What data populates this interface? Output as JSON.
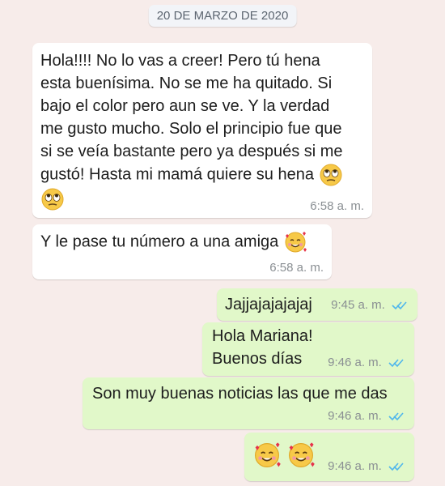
{
  "date_separator": "20 DE MARZO DE 2020",
  "messages": [
    {
      "text_lines": [
        "Hola!!!! No lo vas a creer! Pero tú hena",
        "esta buenísima. No se me ha quitado. Si",
        "bajo el color pero aun se ve. Y la verdad",
        "me gusto mucho. Solo el principio fue que",
        "si se veía bastante pero ya después si me",
        "gustó! Hasta mi mamá quiere su hena"
      ],
      "emojis": [
        "rolling-eyes",
        "rolling-eyes"
      ],
      "time": "6:58 a. m."
    },
    {
      "text": "Y le pase tu número a una amiga",
      "emojis": [
        "smiling-face-with-hearts"
      ],
      "time": "6:58 a. m."
    },
    {
      "text": "Jajjajajajajaj",
      "time": "9:45 a. m.",
      "status": "read"
    },
    {
      "text_lines": [
        "Hola Mariana!",
        "Buenos días"
      ],
      "time": "9:46 a. m.",
      "status": "read"
    },
    {
      "text": "Son muy buenas noticias las que me das",
      "time": "9:46 a. m.",
      "status": "read"
    },
    {
      "emojis": [
        "smiling-face-with-hearts",
        "smiling-face-with-hearts"
      ],
      "time": "9:46 a. m.",
      "status": "read"
    }
  ],
  "colors": {
    "background": "#f7ecea",
    "incoming_bubble": "#ffffff",
    "outgoing_bubble": "#e1f8c9",
    "read_ticks": "#4fb6ec",
    "timestamp": "#8a8f93"
  }
}
